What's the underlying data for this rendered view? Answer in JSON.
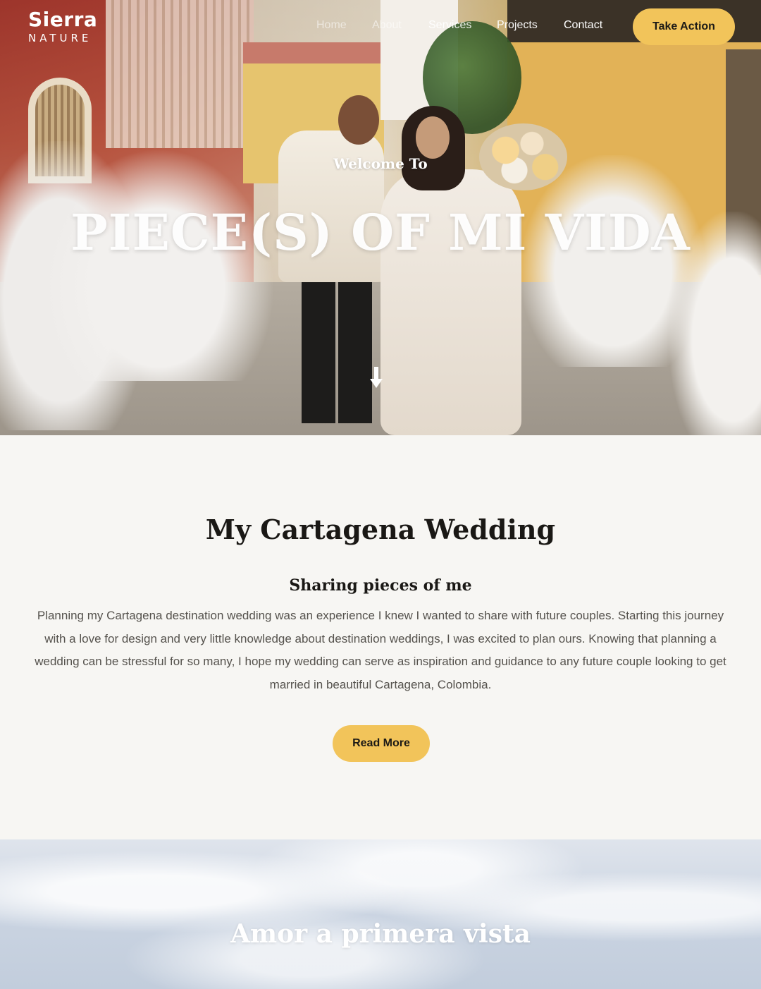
{
  "brand": {
    "name": "Sierra",
    "tagline": "NATURE"
  },
  "nav": {
    "items": [
      "Home",
      "About",
      "Services",
      "Projects",
      "Contact"
    ],
    "cta_label": "Take Action"
  },
  "hero": {
    "eyebrow": "Welcome To",
    "title": "PIECE(S) OF MI VIDA",
    "scroll_icon": "arrow-down-icon"
  },
  "intro": {
    "title": "My Cartagena Wedding",
    "subtitle": "Sharing pieces of me",
    "body": "Planning my Cartagena destination wedding was an experience I knew I wanted to share with future couples. Starting this journey with a love for design and very little knowledge about destination weddings, I was excited to plan ours. Knowing that planning a wedding can be stressful for so many, I hope my wedding can serve as inspiration and guidance to any future couple looking to get married in beautiful Cartagena, Colombia.",
    "button_label": "Read More"
  },
  "next_section": {
    "title": "Amor a primera vista"
  },
  "colors": {
    "accent": "#f2c45a",
    "heading": "#1a1815",
    "body_text": "#55524d",
    "background": "#f7f6f3"
  }
}
